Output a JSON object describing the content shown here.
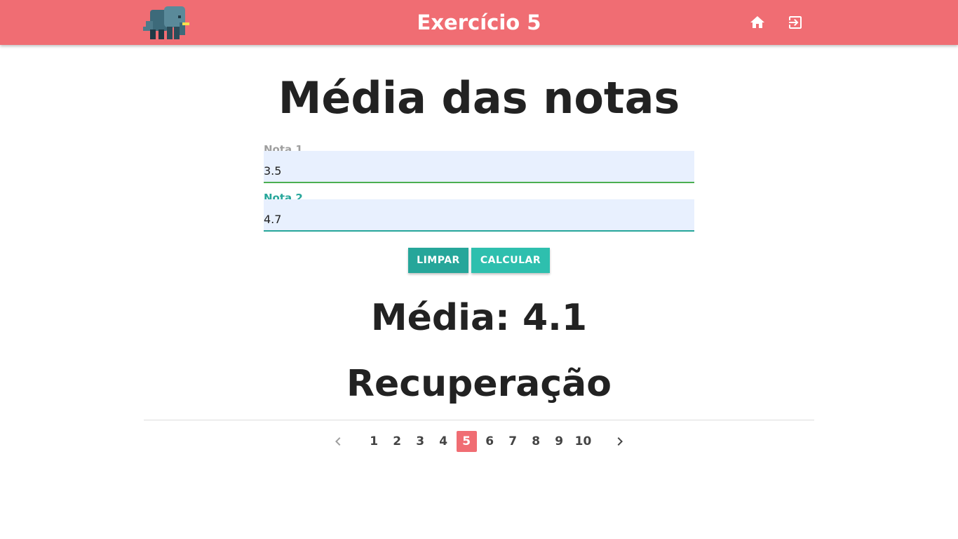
{
  "header": {
    "title": "Exercício 5",
    "logo_icon": "elephant-logo-icon",
    "home_icon": "home-icon",
    "exit_icon": "exit-icon",
    "bar_color": "#f06d73"
  },
  "main": {
    "title": "Média das notas",
    "fields": [
      {
        "label": "Nota 1",
        "value": "3.5"
      },
      {
        "label": "Nota 2",
        "value": "4.7"
      }
    ],
    "buttons": {
      "clear_label": "LIMPAR",
      "calculate_label": "CALCULAR"
    },
    "result": "Média: 4.1",
    "status": "Recuperação"
  },
  "pagination": {
    "pages": [
      "1",
      "2",
      "3",
      "4",
      "5",
      "6",
      "7",
      "8",
      "9",
      "10"
    ],
    "active_page": "5",
    "prev_icon": "chevron-left-icon",
    "next_icon": "chevron-right-icon"
  }
}
